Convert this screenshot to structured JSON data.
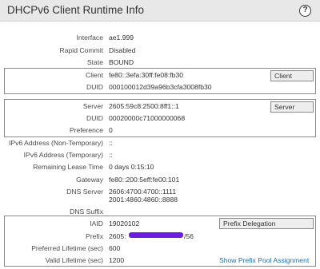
{
  "header": {
    "title": "DHCPv6 Client Runtime Info",
    "help_label": "?"
  },
  "general": {
    "interface_label": "Interface",
    "interface_value": "ae1.999",
    "rapid_commit_label": "Rapid Commit",
    "rapid_commit_value": "Disabled",
    "state_label": "State",
    "state_value": "BOUND"
  },
  "client_box": {
    "tag": "Client",
    "client_label": "Client",
    "client_value": "fe80::3efa:30ff:fe08:fb30",
    "duid_label": "DUID",
    "duid_value": "000100012d39a96b3cfa3008fb30"
  },
  "server_box": {
    "tag": "Server",
    "server_label": "Server",
    "server_value": "2605:59c8:2500:8ff1::1",
    "duid_label": "DUID",
    "duid_value": "00020000c71000000068",
    "preference_label": "Preference",
    "preference_value": "0"
  },
  "addresses": {
    "non_temp_label": "IPv6 Address (Non-Temporary)",
    "non_temp_value": "::",
    "temp_label": "IPv6 Address (Temporary)",
    "temp_value": "::",
    "lease_label": "Remaining Lease Time",
    "lease_value": "0 days 0:15:10",
    "gateway_label": "Gateway",
    "gateway_value": "fe80::200:5eff:fe00:101",
    "dns_label": "DNS Server",
    "dns_value_1": "2606:4700:4700::1111",
    "dns_value_2": "2001:4860:4860::8888",
    "dns_suffix_label": "DNS Suffix",
    "dns_suffix_value": ""
  },
  "prefix_box": {
    "tag": "Prefix Delegation",
    "iaid_label": "IAID",
    "iaid_value": "19020102",
    "prefix_label": "Prefix",
    "prefix_start": "2605:",
    "prefix_end": "/56",
    "preferred_label": "Preferred Lifetime (sec)",
    "preferred_value": "600",
    "valid_label": "Valid Lifetime (sec)",
    "valid_value": "1200",
    "pool_link": "Show Prefix Pool Assignment"
  }
}
